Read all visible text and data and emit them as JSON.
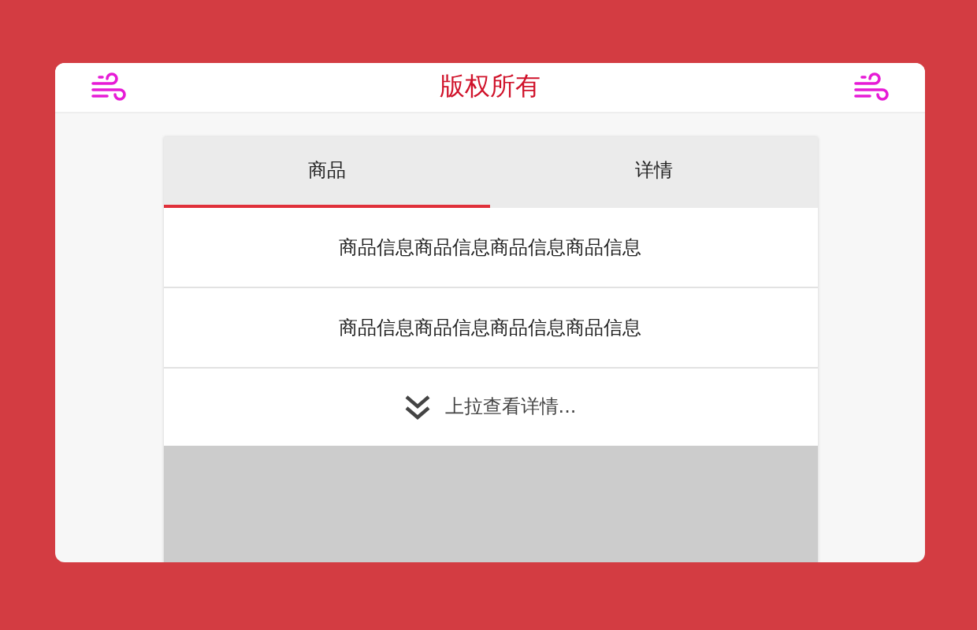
{
  "header": {
    "title": "版权所有"
  },
  "tabs": [
    {
      "label": "商品",
      "selected": true
    },
    {
      "label": "详情",
      "selected": false
    }
  ],
  "items": [
    "商品信息商品信息商品信息商品信息",
    "商品信息商品信息商品信息商品信息"
  ],
  "pull_hint": {
    "label": "上拉查看详情..."
  }
}
